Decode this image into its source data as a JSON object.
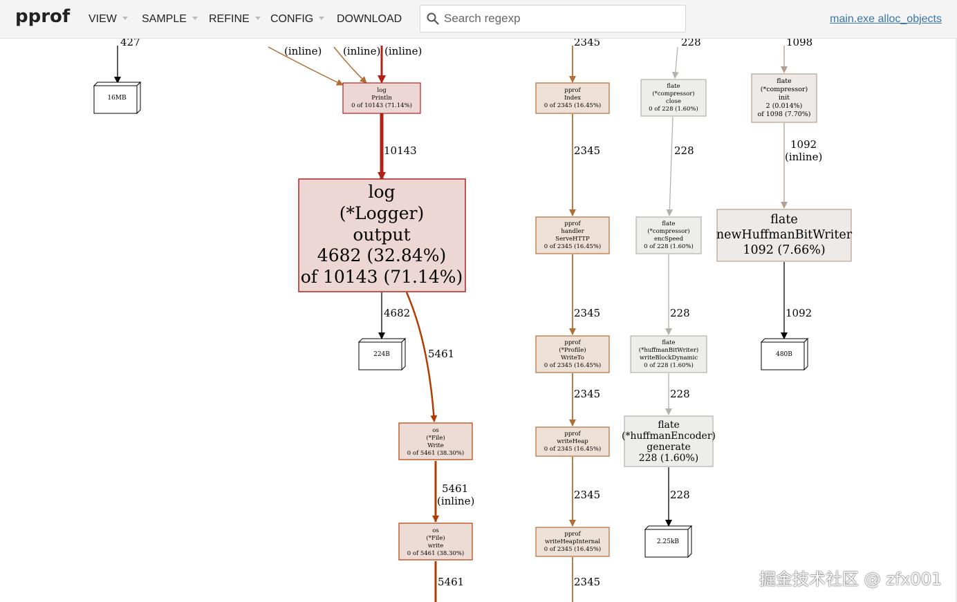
{
  "header": {
    "logo": "pprof",
    "menus": [
      "VIEW",
      "SAMPLE",
      "REFINE",
      "CONFIG",
      "DOWNLOAD"
    ],
    "search_placeholder": "Search regexp",
    "profile_link": "main.exe alloc_objects"
  },
  "colors": {
    "hot_node_fill": "#edd7d5",
    "hot_node_border": "#b2201a",
    "warm_node_fill": "#eddcd5",
    "warm_node_border": "#b23c00",
    "pprof_node_fill": "#ede0d6",
    "pprof_node_border": "#b26d32",
    "cool_node_fill": "#ededec",
    "cool_node_border": "#b2b1ac",
    "flate_node_fill": "#edeae7",
    "flate_node_border": "#b29f8f",
    "accent_link": "#3a75b0"
  },
  "graph": {
    "nodes": [
      {
        "id": "n16mb",
        "lines": [
          "16MB"
        ],
        "kind": "alloc"
      },
      {
        "id": "println",
        "lines": [
          "log",
          "Println",
          "0 of 10143 (71.14%)"
        ],
        "kind": "hot"
      },
      {
        "id": "output",
        "lines": [
          "log",
          "(*Logger)",
          "output",
          "4682 (32.84%)",
          "of 10143 (71.14%)"
        ],
        "kind": "hot"
      },
      {
        "id": "n224b",
        "lines": [
          "224B"
        ],
        "kind": "alloc"
      },
      {
        "id": "oswrite1",
        "lines": [
          "os",
          "(*File)",
          "Write",
          "0 of 5461 (38.30%)"
        ],
        "kind": "warm"
      },
      {
        "id": "oswrite2",
        "lines": [
          "os",
          "(*File)",
          "write",
          "0 of 5461 (38.30%)"
        ],
        "kind": "warm"
      },
      {
        "id": "pindex",
        "lines": [
          "pprof",
          "Index",
          "0 of 2345 (16.45%)"
        ],
        "kind": "pprof"
      },
      {
        "id": "phandler",
        "lines": [
          "pprof",
          "handler",
          "ServeHTTP",
          "0 of 2345 (16.45%)"
        ],
        "kind": "pprof"
      },
      {
        "id": "pwriteto",
        "lines": [
          "pprof",
          "(*Profile)",
          "WriteTo",
          "0 of 2345 (16.45%)"
        ],
        "kind": "pprof"
      },
      {
        "id": "pwriteheap",
        "lines": [
          "pprof",
          "writeHeap",
          "0 of 2345 (16.45%)"
        ],
        "kind": "pprof"
      },
      {
        "id": "pwriteheapint",
        "lines": [
          "pprof",
          "writeHeapInternal",
          "0 of 2345 (16.45%)"
        ],
        "kind": "pprof"
      },
      {
        "id": "fclose",
        "lines": [
          "flate",
          "(*compressor)",
          "close",
          "0 of 228 (1.60%)"
        ],
        "kind": "cool"
      },
      {
        "id": "fencspeed",
        "lines": [
          "flate",
          "(*compressor)",
          "encSpeed",
          "0 of 228 (1.60%)"
        ],
        "kind": "cool"
      },
      {
        "id": "fwbd",
        "lines": [
          "flate",
          "(*huffmanBitWriter)",
          "writeBlockDynamic",
          "0 of 228 (1.60%)"
        ],
        "kind": "cool"
      },
      {
        "id": "fgenerate",
        "lines": [
          "flate",
          "(*huffmanEncoder)",
          "generate",
          "228 (1.60%)"
        ],
        "kind": "cool"
      },
      {
        "id": "n225kb",
        "lines": [
          "2.25kB"
        ],
        "kind": "alloc"
      },
      {
        "id": "finit",
        "lines": [
          "flate",
          "(*compressor)",
          "init",
          "2 (0.014%)",
          "of 1098 (7.70%)"
        ],
        "kind": "flate"
      },
      {
        "id": "fnewhbw",
        "lines": [
          "flate",
          "newHuffmanBitWriter",
          "1092 (7.66%)"
        ],
        "kind": "flate"
      },
      {
        "id": "n480b",
        "lines": [
          "480B"
        ],
        "kind": "alloc"
      }
    ],
    "edge_labels": [
      {
        "id": "e-top-a",
        "text": "427"
      },
      {
        "id": "e-top-b",
        "text": "(inline)"
      },
      {
        "id": "e-top-c",
        "text": "(inline)"
      },
      {
        "id": "e-top-d",
        "text": "(inline)"
      },
      {
        "id": "e-println-output",
        "text": "10143"
      },
      {
        "id": "e-output-224b",
        "text": "4682"
      },
      {
        "id": "e-output-oswrite",
        "text": "5461"
      },
      {
        "id": "e-oswrite-write",
        "text": "5461"
      },
      {
        "id": "e-oswrite-write-inline",
        "text": "(inline)"
      },
      {
        "id": "e-write-down",
        "text": "5461"
      },
      {
        "id": "e-top-pprof",
        "text": "2345"
      },
      {
        "id": "e-index-handler",
        "text": "2345"
      },
      {
        "id": "e-handler-writeto",
        "text": "2345"
      },
      {
        "id": "e-writeto-writeheap",
        "text": "2345"
      },
      {
        "id": "e-writeheap-int",
        "text": "2345"
      },
      {
        "id": "e-int-down",
        "text": "2345"
      },
      {
        "id": "e-top-close",
        "text": "228"
      },
      {
        "id": "e-close-encspeed",
        "text": "228"
      },
      {
        "id": "e-encspeed-wbd",
        "text": "228"
      },
      {
        "id": "e-wbd-generate",
        "text": "228"
      },
      {
        "id": "e-generate-kb",
        "text": "228"
      },
      {
        "id": "e-top-init",
        "text": "1098"
      },
      {
        "id": "e-init-newhbw",
        "text": "1092"
      },
      {
        "id": "e-init-newhbw-inline",
        "text": "(inline)"
      },
      {
        "id": "e-newhbw-480b",
        "text": "1092"
      }
    ]
  },
  "watermark": "掘金技术社区 @ zfx001"
}
